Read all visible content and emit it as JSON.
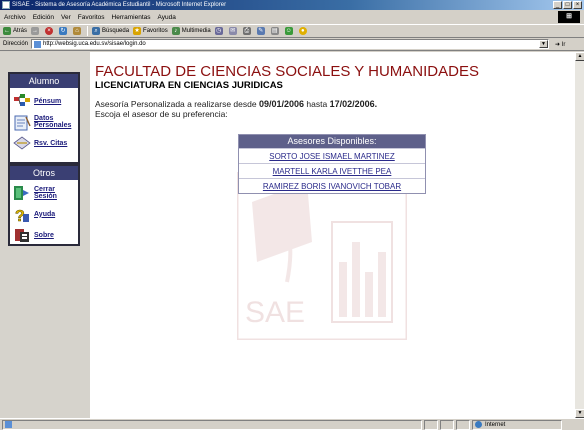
{
  "window": {
    "title": "SISAE - Sistema de Asesoría Académica Estudiantil - Microsoft Internet Explorer",
    "min": "_",
    "max": "□",
    "close": "×"
  },
  "menu": [
    "Archivo",
    "Edición",
    "Ver",
    "Favoritos",
    "Herramientas",
    "Ayuda"
  ],
  "toolbar": {
    "back": "Atrás",
    "search": "Búsqueda",
    "favorites": "Favoritos",
    "multimedia": "Multimedia"
  },
  "address": {
    "label": "Dirección",
    "url": "http://websig.uca.edu.sv/sisae/login.do",
    "go": "Ir"
  },
  "sidebar": {
    "alumno_title": "Alumno",
    "alumno_items": [
      "Pénsum",
      "Datos Personales",
      "Rsv. Citas"
    ],
    "otros_title": "Otros",
    "otros_items": [
      "Cerrar Sesión",
      "Ayuda",
      "Sobre"
    ]
  },
  "main": {
    "faculty": "FACULTAD DE CIENCIAS SOCIALES Y HUMANIDADES",
    "program": "LICENCIATURA EN CIENCIAS JURIDICAS",
    "asesoria_prefix": "Asesoría Personalizada a realizarse desde",
    "date_from": "09/01/2006",
    "asesoria_mid": "hasta",
    "date_to": "17/02/2006.",
    "choose": "Escoja el asesor de su preferencia:",
    "watermark_text": "SAE"
  },
  "asesores": {
    "header": "Asesores Disponibles:",
    "list": [
      "SORTO JOSE ISMAEL MARTINEZ",
      "MARTELL KARLA IVETTHE PEA",
      "RAMIREZ BORIS IVANOVICH TOBAR"
    ]
  },
  "status": {
    "zone": "Internet"
  },
  "colors": {
    "faculty_title": "#8b0f0f",
    "panel_header": "#3a3f73",
    "asesores_header": "#5e608a",
    "link": "#2a2a8a"
  }
}
